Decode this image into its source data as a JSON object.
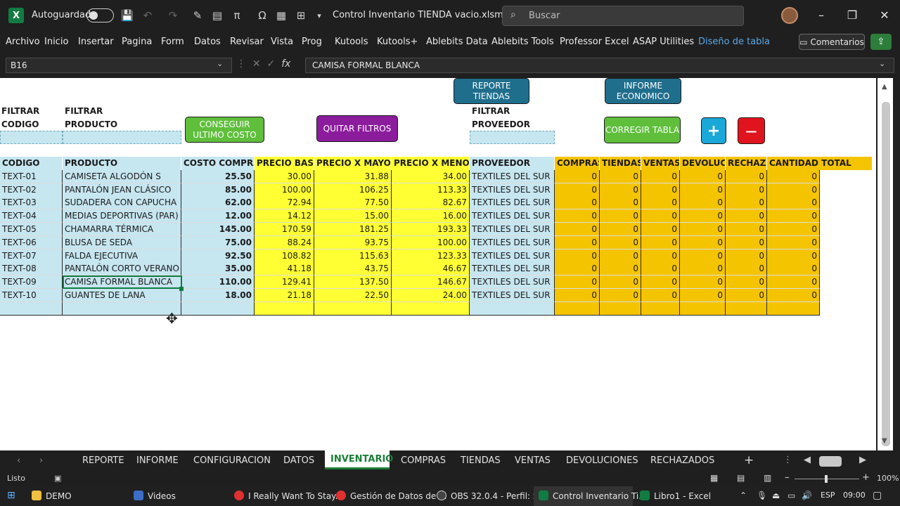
{
  "titlebar": {
    "autosave": "Autoguardado",
    "title": "Control Inventario TIENDA vacio.xlsm - E...",
    "search_placeholder": "Buscar"
  },
  "menu": [
    "Archivo",
    "Inicio",
    "Insertar",
    "Pagina",
    "Form",
    "Datos",
    "Revisar",
    "Vista",
    "Prog",
    "Kutools",
    "Kutools+",
    "Ablebits Data",
    "Ablebits Tools",
    "Professor Excel",
    "ASAP Utilities",
    "Diseño de tabla"
  ],
  "comments_label": "Comentarios",
  "formula": {
    "namebox": "B16",
    "content": "CAMISA FORMAL BLANCA"
  },
  "sheet": {
    "labels": {
      "filter_code_1": "FILTRAR",
      "filter_code_2": "CODIGO",
      "filter_prod_1": "FILTRAR",
      "filter_prod_2": "PRODUCTO",
      "filter_prov_1": "FILTRAR",
      "filter_prov_2": "PROVEEDOR"
    },
    "buttons": {
      "reporte_tiendas": "REPORTE TIENDAS",
      "informe_economico": "INFORME ECONOMICO",
      "conseguir": "CONSEGUIR ULTIMO COSTO",
      "quitar": "QUITAR FILTROS",
      "corregir": "CORREGIR TABLA",
      "plus": "+",
      "minus": "—"
    },
    "headers": [
      "CODIGO",
      "PRODUCTO",
      "COSTO COMPRA",
      "PRECIO BASE",
      "PRECIO X MAYOR",
      "PRECIO X MENOR",
      "PROVEEDOR",
      "COMPRAS",
      "TIENDAS",
      "VENTAS T",
      "DEVOLUCI",
      "RECHAZA",
      "CANTIDAD TOTAL"
    ],
    "rows": [
      [
        "TEXT-01",
        "CAMISETA ALGODÓN S",
        "25.50",
        "30.00",
        "31.88",
        "34.00",
        "TEXTILES DEL SUR",
        "0",
        "0",
        "0",
        "0",
        "0",
        "0"
      ],
      [
        "TEXT-02",
        "PANTALÓN JEAN CLÁSICO",
        "85.00",
        "100.00",
        "106.25",
        "113.33",
        "TEXTILES DEL SUR",
        "0",
        "0",
        "0",
        "0",
        "0",
        "0"
      ],
      [
        "TEXT-03",
        "SUDADERA CON CAPUCHA",
        "62.00",
        "72.94",
        "77.50",
        "82.67",
        "TEXTILES DEL SUR",
        "0",
        "0",
        "0",
        "0",
        "0",
        "0"
      ],
      [
        "TEXT-04",
        "MEDIAS DEPORTIVAS (PAR)",
        "12.00",
        "14.12",
        "15.00",
        "16.00",
        "TEXTILES DEL SUR",
        "0",
        "0",
        "0",
        "0",
        "0",
        "0"
      ],
      [
        "TEXT-05",
        "CHAMARRA TÉRMICA",
        "145.00",
        "170.59",
        "181.25",
        "193.33",
        "TEXTILES DEL SUR",
        "0",
        "0",
        "0",
        "0",
        "0",
        "0"
      ],
      [
        "TEXT-06",
        "BLUSA DE SEDA",
        "75.00",
        "88.24",
        "93.75",
        "100.00",
        "TEXTILES DEL SUR",
        "0",
        "0",
        "0",
        "0",
        "0",
        "0"
      ],
      [
        "TEXT-07",
        "FALDA EJECUTIVA",
        "92.50",
        "108.82",
        "115.63",
        "123.33",
        "TEXTILES DEL SUR",
        "0",
        "0",
        "0",
        "0",
        "0",
        "0"
      ],
      [
        "TEXT-08",
        "PANTALÓN CORTO VERANO",
        "35.00",
        "41.18",
        "43.75",
        "46.67",
        "TEXTILES DEL SUR",
        "0",
        "0",
        "0",
        "0",
        "0",
        "0"
      ],
      [
        "TEXT-09",
        "CAMISA FORMAL BLANCA",
        "110.00",
        "129.41",
        "137.50",
        "146.67",
        "TEXTILES DEL SUR",
        "0",
        "0",
        "0",
        "0",
        "0",
        "0"
      ],
      [
        "TEXT-10",
        "GUANTES DE LANA",
        "18.00",
        "21.18",
        "22.50",
        "24.00",
        "TEXTILES DEL SUR",
        "0",
        "0",
        "0",
        "0",
        "0",
        "0"
      ]
    ]
  },
  "tabs": [
    "REPORTE",
    "INFORME",
    "CONFIGURACION",
    "DATOS",
    "INVENTARIO",
    "COMPRAS",
    "TIENDAS",
    "VENTAS",
    "DEVOLUCIONES",
    "RECHAZADOS"
  ],
  "active_tab": "INVENTARIO",
  "status": {
    "ready": "Listo",
    "zoom": "100%"
  },
  "taskbar": {
    "items": [
      "DEMO",
      "Videos",
      "I Really Want To Stay...",
      "Gestión de Datos de ...",
      "OBS 32.0.4 - Perfil: Si...",
      "Control Inventario Ti...",
      "Libro1 - Excel"
    ],
    "lang": "ESP",
    "time": "09:00"
  },
  "colors": {
    "blue_cell": "#c6e6f0",
    "yellow_cell": "#ffff33",
    "orange_cell": "#f5c400",
    "button_blue": "#1f6e8c",
    "button_green": "#5fbf3b",
    "button_purple": "#8b1c9c",
    "button_red": "#e0141d",
    "button_cyan": "#19a8d8"
  }
}
